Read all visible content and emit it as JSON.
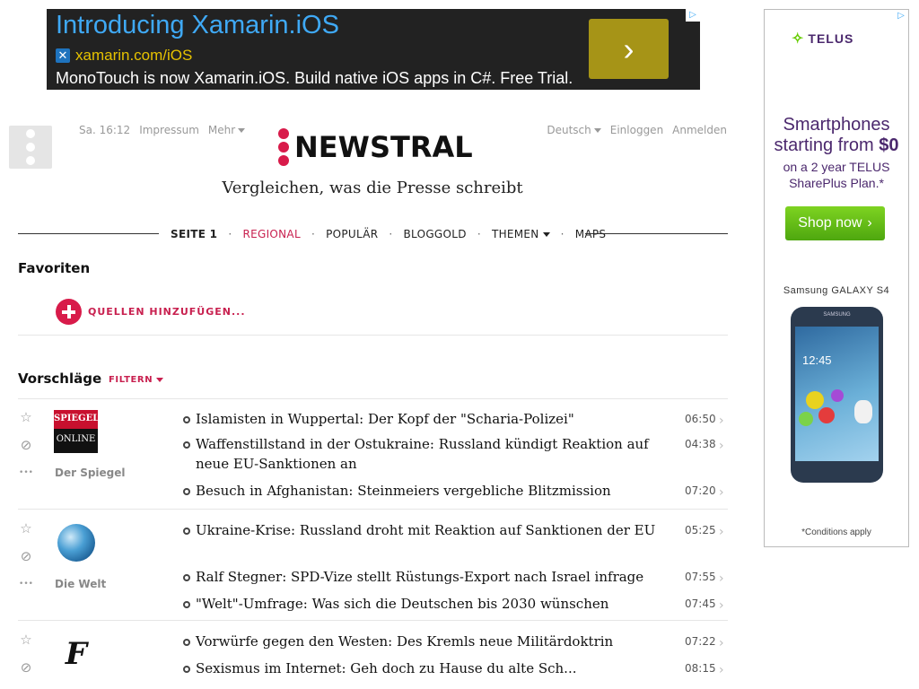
{
  "top_ad": {
    "title": "Introducing Xamarin.iOS",
    "url": "xamarin.com/iOS",
    "description": "MonoTouch is now Xamarin.iOS. Build native iOS apps in C#. Free Trial.",
    "arrow": "›",
    "adchoices_icon": "▷"
  },
  "header": {
    "datetime": "Sa. 16:12",
    "impressum": "Impressum",
    "mehr": "Mehr",
    "language": "Deutsch",
    "login": "Einloggen",
    "register": "Anmelden",
    "logo_text": "NEWSTRAL",
    "tagline": "Vergleichen, was die Presse schreibt"
  },
  "nav": {
    "items": [
      "SEITE 1",
      "REGIONAL",
      "POPULÄR",
      "BLOGGOLD",
      "THEMEN",
      "MAPS"
    ],
    "separator": "·"
  },
  "favorites": {
    "title": "Favoriten",
    "add_sources": "QUELLEN HINZUFÜGEN..."
  },
  "suggestions": {
    "title": "Vorschläge",
    "filter": "FILTERN"
  },
  "icons": {
    "star": "☆",
    "block": "⊘",
    "more": "•••",
    "chevron": "›"
  },
  "sources": [
    {
      "name": "Der Spiegel",
      "logo_line1": "SPIEGEL",
      "logo_line2": "ONLINE",
      "articles": [
        {
          "title": "Islamisten in Wuppertal: Der Kopf der \"Scharia-Polizei\"",
          "time": "06:50"
        },
        {
          "title": "Waffenstillstand in der Ostukraine: Russland kündigt Reaktion auf neue EU-Sanktionen an",
          "time": "04:38"
        },
        {
          "title": "Besuch in Afghanistan: Steinmeiers vergebliche Blitzmission",
          "time": "07:20"
        }
      ]
    },
    {
      "name": "Die Welt",
      "articles": [
        {
          "title": "Ukraine-Krise: Russland droht mit Reaktion auf Sanktionen der EU",
          "time": "05:25"
        },
        {
          "title": "Ralf Stegner: SPD-Vize stellt Rüstungs-Export nach Israel infrage",
          "time": "07:55"
        },
        {
          "title": "\"Welt\"-Umfrage: Was sich die Deutschen bis 2030 wünschen",
          "time": "07:45"
        }
      ]
    },
    {
      "name": "",
      "logo_letter": "F",
      "articles": [
        {
          "title": "Vorwürfe gegen den Westen: Des Kremls neue Militärdoktrin",
          "time": "07:22"
        },
        {
          "title": "Sexismus im Internet: Geh doch zu Hause du alte Sch...",
          "time": "08:15"
        }
      ]
    }
  ],
  "right_ad": {
    "brand": "TELUS",
    "headline_1": "Smartphones",
    "headline_2": "starting from",
    "price": "$0",
    "sub_1": "on a 2 year TELUS",
    "sub_2": "SharePlus Plan.*",
    "button": "Shop now",
    "button_arrow": "›",
    "product": "Samsung GALAXY S4",
    "phone_clock": "12:45",
    "phone_brand": "SAMSUNG",
    "conditions": "*Conditions apply",
    "adchoices_icon": "▷"
  },
  "colors": {
    "accent": "#d81b4a",
    "accent_text": "#c8204f",
    "ad_title": "#3fa9f5",
    "ad_url": "#e6c200",
    "telus_purple": "#4b286d",
    "telus_green": "#66cc00"
  }
}
